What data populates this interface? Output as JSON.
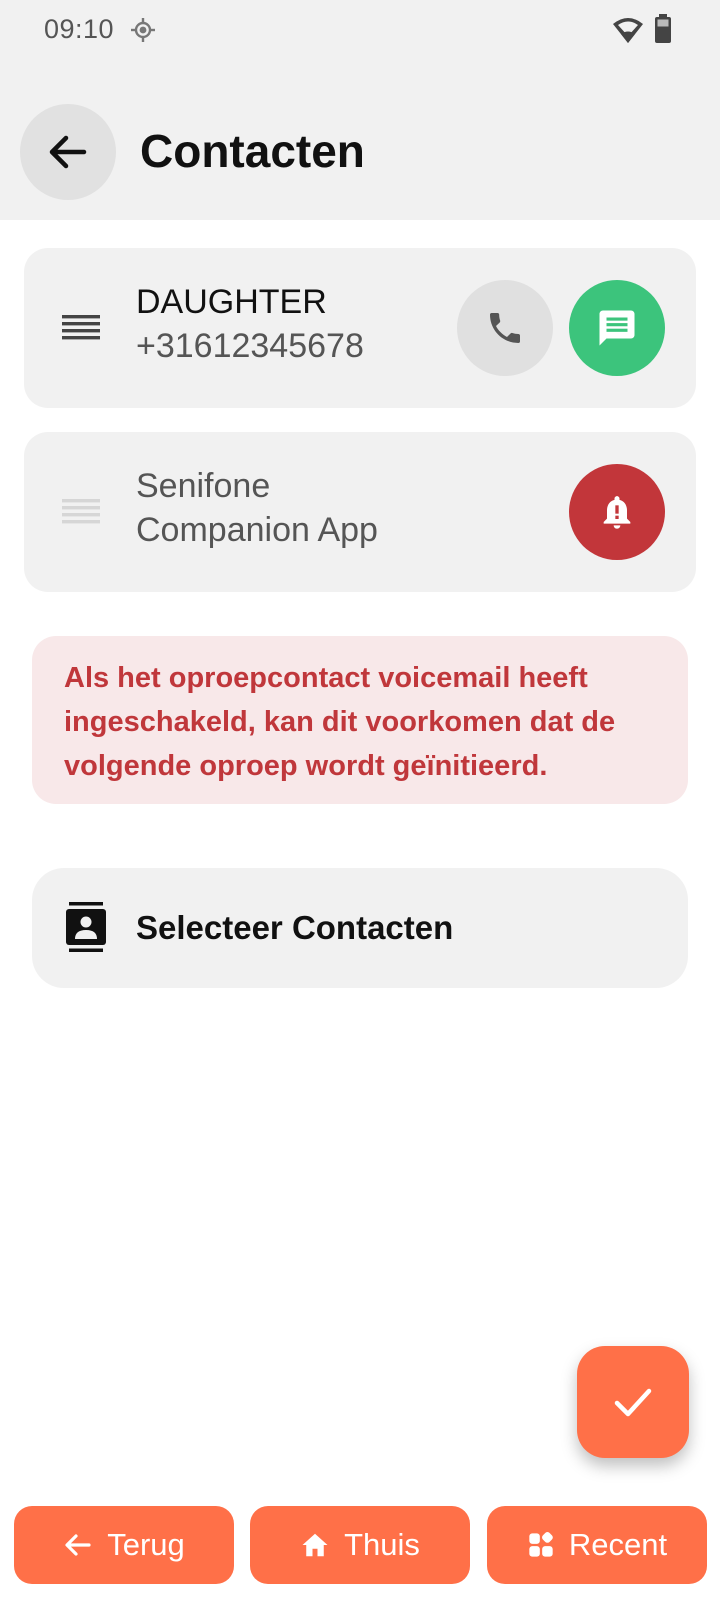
{
  "status_bar": {
    "time": "09:10",
    "location_icon": "location-icon",
    "wifi_icon": "wifi-icon",
    "battery_icon": "battery-icon"
  },
  "header": {
    "back_icon": "arrow-left-icon",
    "title": "Contacten"
  },
  "contacts": [
    {
      "name": "DAUGHTER",
      "number": "+31612345678",
      "actions": [
        "phone-icon",
        "message-icon"
      ]
    },
    {
      "name_line1": "Senifone",
      "name_line2": "Companion App",
      "actions": [
        "alarm-bell-icon"
      ]
    }
  ],
  "warning": {
    "text": "Als het oproepcontact voicemail heeft ingeschakeld, kan dit voorkomen dat de volgende oproep wordt geïnitieerd."
  },
  "select_contacts": {
    "icon": "contacts-book-icon",
    "label": "Selecteer Contacten"
  },
  "fab": {
    "icon": "check-icon"
  },
  "bottom_nav": {
    "back_label": "Terug",
    "home_label": "Thuis",
    "recent_label": "Recent"
  },
  "colors": {
    "accent": "#ff7048",
    "sms_green": "#3cc47c",
    "alarm_red": "#c2363a",
    "warning_bg": "#f8e8e9",
    "warning_text": "#c0373b",
    "card_bg": "#f1f1f1"
  }
}
